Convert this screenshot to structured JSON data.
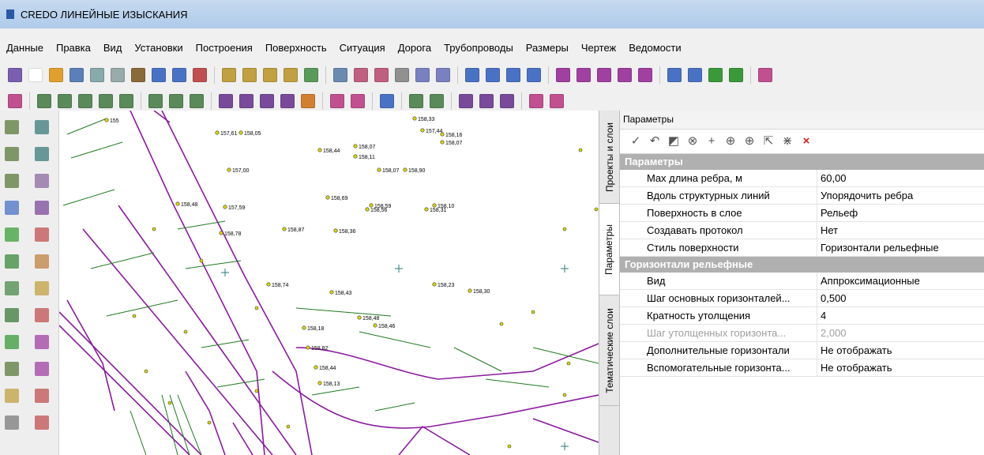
{
  "title": "CREDO ЛИНЕЙНЫЕ ИЗЫСКАНИЯ",
  "menu": [
    "Данные",
    "Правка",
    "Вид",
    "Установки",
    "Построения",
    "Поверхность",
    "Ситуация",
    "Дорога",
    "Трубопроводы",
    "Размеры",
    "Чертеж",
    "Ведомости"
  ],
  "side_tabs": [
    "Проекты и слои",
    "Параметры",
    "Тематические слои"
  ],
  "panel": {
    "title": "Параметры",
    "groups": [
      {
        "name": "Параметры",
        "rows": [
          {
            "name": "Max длина ребра, м",
            "value": "60,00"
          },
          {
            "name": "Вдоль структурных линий",
            "value": "Упорядочить ребра"
          },
          {
            "name": "Поверхность в слое",
            "value": "Рельеф"
          },
          {
            "name": "Создавать протокол",
            "value": "Нет"
          },
          {
            "name": "Стиль поверхности",
            "value": "Горизонтали рельефные"
          }
        ]
      },
      {
        "name": "Горизонтали рельефные",
        "rows": [
          {
            "name": "Вид",
            "value": "Аппроксимационные"
          },
          {
            "name": "Шаг основных горизонталей...",
            "value": "0,500"
          },
          {
            "name": "Кратность утолщения",
            "value": "4"
          },
          {
            "name": "Шаг утолщенных горизонта...",
            "value": "2,000"
          },
          {
            "name": "Дополнительные горизонтали",
            "value": "Не отображать"
          },
          {
            "name": "Вспомогательные горизонта...",
            "value": "Не отображать"
          }
        ]
      }
    ]
  },
  "map_labels": [
    "155",
    "157,61",
    "158,48",
    "157,59",
    "157,00",
    "158,05",
    "158,44",
    "158,07",
    "158,11",
    "158,07",
    "158,90",
    "158,33",
    "157,44",
    "158,16",
    "158,07",
    "158,59",
    "158,69",
    "158,56",
    "158,31",
    "158,10",
    "158,78",
    "158,87",
    "158,36",
    "158,74",
    "158,43",
    "158,23",
    "158,30",
    "158,46",
    "158,48",
    "158,18",
    "158,82",
    "158,44",
    "158,13"
  ]
}
